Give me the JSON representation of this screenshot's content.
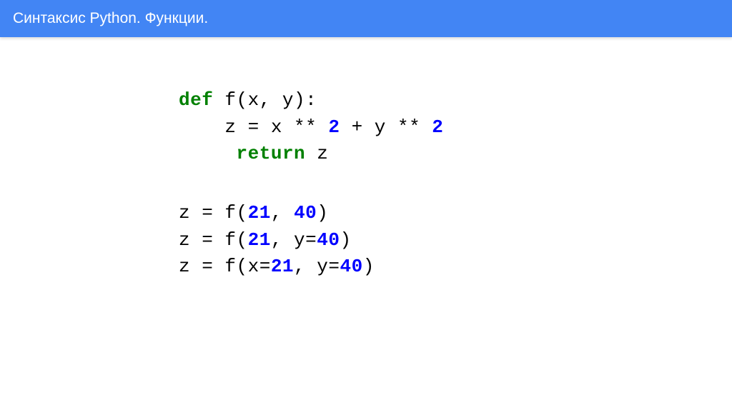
{
  "header": {
    "title": "Синтаксис Python. Функции."
  },
  "code": {
    "def_kw": "def",
    "func_sig": " f(x, y):",
    "indent": "    ",
    "body1_pre": "z = x ** ",
    "body1_num1": "2",
    "body1_mid": " + y ** ",
    "body1_num2": "2",
    "return_kw": "return",
    "return_leading": " ",
    "return_var": " z",
    "call1_pre": "z = f(",
    "call1_a": "21",
    "call1_sep": ", ",
    "call1_b": "40",
    "call1_close": ")",
    "call2_pre": "z = f(",
    "call2_a": "21",
    "call2_sep": ", y=",
    "call2_b": "40",
    "call2_close": ")",
    "call3_pre": "z = f(x=",
    "call3_a": "21",
    "call3_sep": ", y=",
    "call3_b": "40",
    "call3_close": ")"
  }
}
